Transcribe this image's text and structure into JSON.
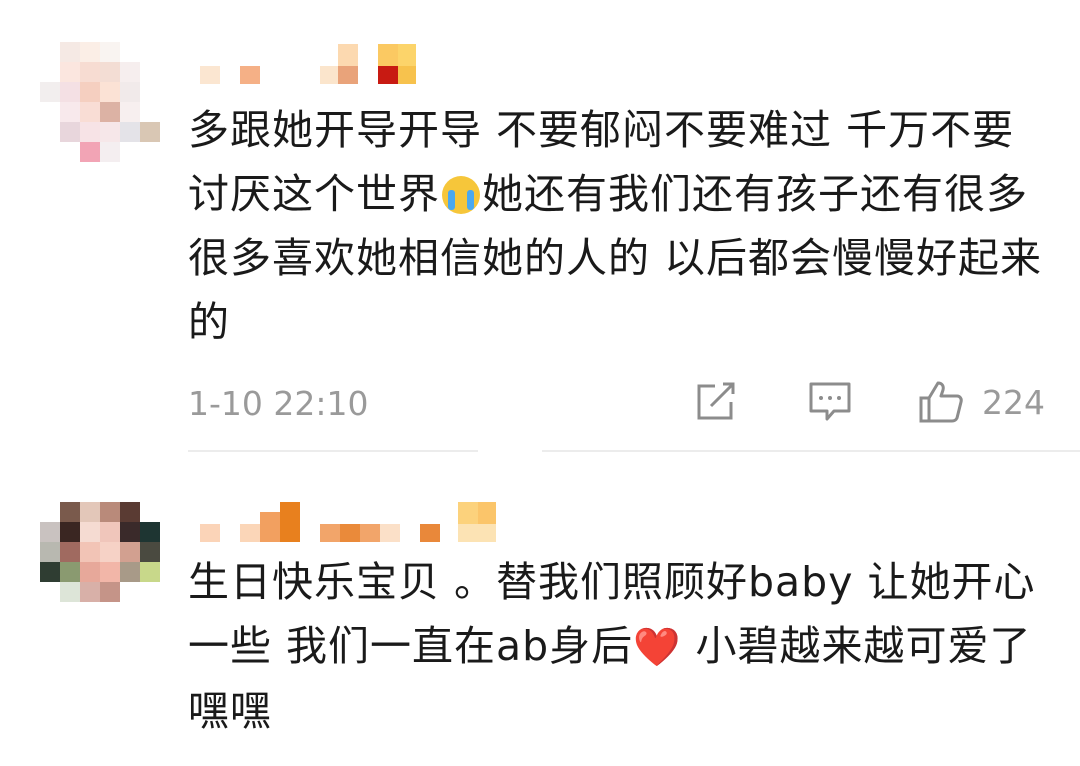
{
  "comments": [
    {
      "username_blurred": true,
      "text_parts": [
        "多跟她开导开导  不要郁闷不要难过  千万不要讨厌这个世界",
        "她还有我们还有孩子还有很多很多喜欢她相信她的人的  以后都会慢慢好起来的"
      ],
      "emoji": "crying-face",
      "time": "1-10 22:10",
      "like_count": "224"
    },
    {
      "username_blurred": true,
      "text_parts": [
        "生日快乐宝贝 。替我们照顾好baby 让她开心一些 我们一直在ab身后",
        " 小碧越来越可爱了嘿嘿"
      ],
      "emoji": "❤️"
    }
  ],
  "icons": {
    "share": "share-icon",
    "reply": "comment-icon",
    "like": "thumbs-up-icon"
  },
  "colors": {
    "text": "#1a1a1a",
    "meta": "#9a9a9a",
    "divider": "#ececec"
  }
}
